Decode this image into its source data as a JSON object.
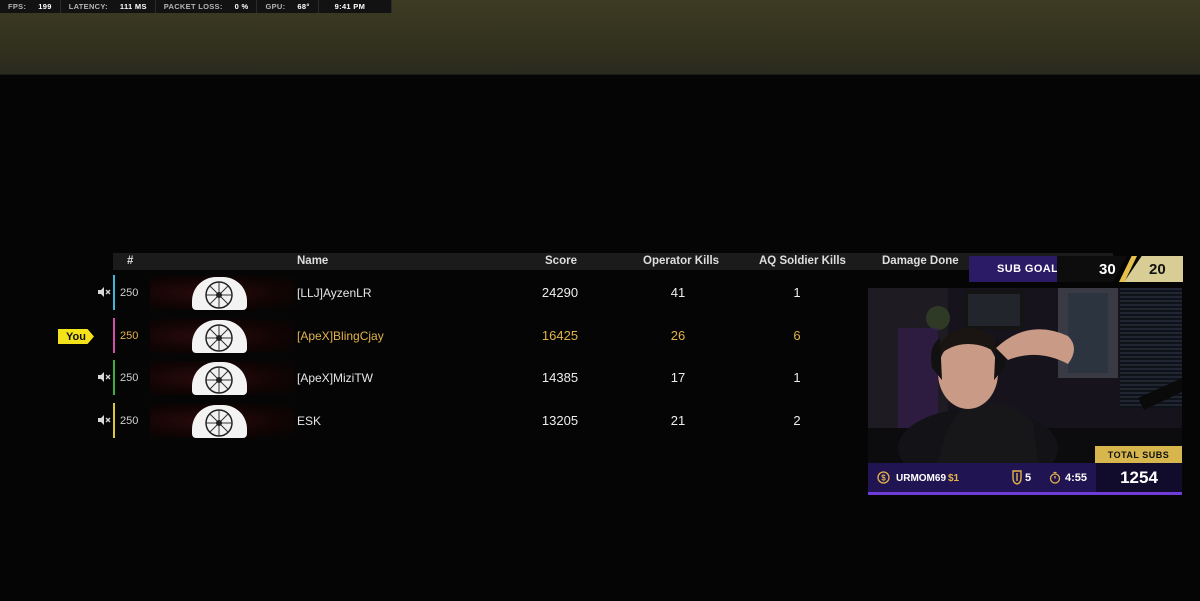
{
  "stats": {
    "fps_label": "FPS:",
    "fps_value": "199",
    "latency_label": "LATENCY:",
    "latency_value": "111 MS",
    "packet_loss_label": "PACKET LOSS:",
    "packet_loss_value": "0 %",
    "gpu_label": "GPU:",
    "gpu_value": "68°",
    "time": "9:41 PM"
  },
  "scoreboard": {
    "headers": {
      "rank": "#",
      "name": "Name",
      "score": "Score",
      "operator_kills": "Operator Kills",
      "aq_soldier_kills": "AQ Soldier Kills",
      "damage_done": "Damage Done"
    },
    "you_label": "You",
    "rows": [
      {
        "level": "250",
        "name": "[LLJ]AyzenLR",
        "score": "24290",
        "operator_kills": "41",
        "aq_kills": "1",
        "bar_color": "#3fb6d6"
      },
      {
        "level": "250",
        "name": "[ApeX]BlingCjay",
        "score": "16425",
        "operator_kills": "26",
        "aq_kills": "6",
        "bar_color": "#d24fa8"
      },
      {
        "level": "250",
        "name": "[ApeX]MiziTW",
        "score": "14385",
        "operator_kills": "17",
        "aq_kills": "1",
        "bar_color": "#3fae3a"
      },
      {
        "level": "250",
        "name": "ESK",
        "score": "13205",
        "operator_kills": "21",
        "aq_kills": "2",
        "bar_color": "#d8c93a"
      }
    ]
  },
  "sub_goal": {
    "label": "SUB GOAL",
    "current": "30",
    "goal": "20"
  },
  "sub_ticker": {
    "total_subs_label": "TOTAL SUBS",
    "latest_subscriber": "URMOM69",
    "latest_amount": "$1",
    "gift_count": "5",
    "timer": "4:55",
    "total_subs": "1254"
  }
}
